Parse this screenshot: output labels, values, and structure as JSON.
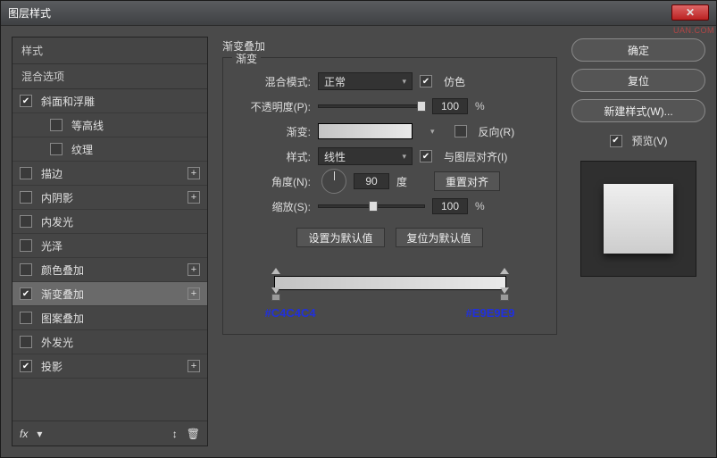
{
  "window": {
    "title": "图层样式"
  },
  "left": {
    "header": "样式",
    "sub": "混合选项",
    "items": [
      {
        "label": "斜面和浮雕",
        "checked": true,
        "plus": false,
        "indent": false
      },
      {
        "label": "等高线",
        "checked": false,
        "plus": false,
        "indent": true
      },
      {
        "label": "纹理",
        "checked": false,
        "plus": false,
        "indent": true
      },
      {
        "label": "描边",
        "checked": false,
        "plus": true,
        "indent": false
      },
      {
        "label": "内阴影",
        "checked": false,
        "plus": true,
        "indent": false
      },
      {
        "label": "内发光",
        "checked": false,
        "plus": false,
        "indent": false
      },
      {
        "label": "光泽",
        "checked": false,
        "plus": false,
        "indent": false
      },
      {
        "label": "颜色叠加",
        "checked": false,
        "plus": true,
        "indent": false
      },
      {
        "label": "渐变叠加",
        "checked": true,
        "plus": true,
        "indent": false,
        "selected": true
      },
      {
        "label": "图案叠加",
        "checked": false,
        "plus": false,
        "indent": false
      },
      {
        "label": "外发光",
        "checked": false,
        "plus": false,
        "indent": false
      },
      {
        "label": "投影",
        "checked": true,
        "plus": true,
        "indent": false
      }
    ],
    "footer_fx": "fx"
  },
  "mid": {
    "title": "渐变叠加",
    "legend": "渐变",
    "blend_label": "混合模式:",
    "blend_value": "正常",
    "dither": "仿色",
    "opacity_label": "不透明度(P):",
    "opacity_value": "100",
    "pct": "%",
    "grad_label": "渐变:",
    "reverse": "反向(R)",
    "style_label": "样式:",
    "style_value": "线性",
    "align": "与图层对齐(I)",
    "angle_label": "角度(N):",
    "angle_value": "90",
    "deg": "度",
    "reset_align": "重置对齐",
    "scale_label": "缩放(S):",
    "scale_value": "100",
    "make_default": "设置为默认值",
    "reset_default": "复位为默认值",
    "hex_left": "#C4C4C4",
    "hex_right": "#E9E9E9"
  },
  "right": {
    "ok": "确定",
    "cancel": "复位",
    "new_style": "新建样式(W)...",
    "preview": "预览(V)"
  }
}
